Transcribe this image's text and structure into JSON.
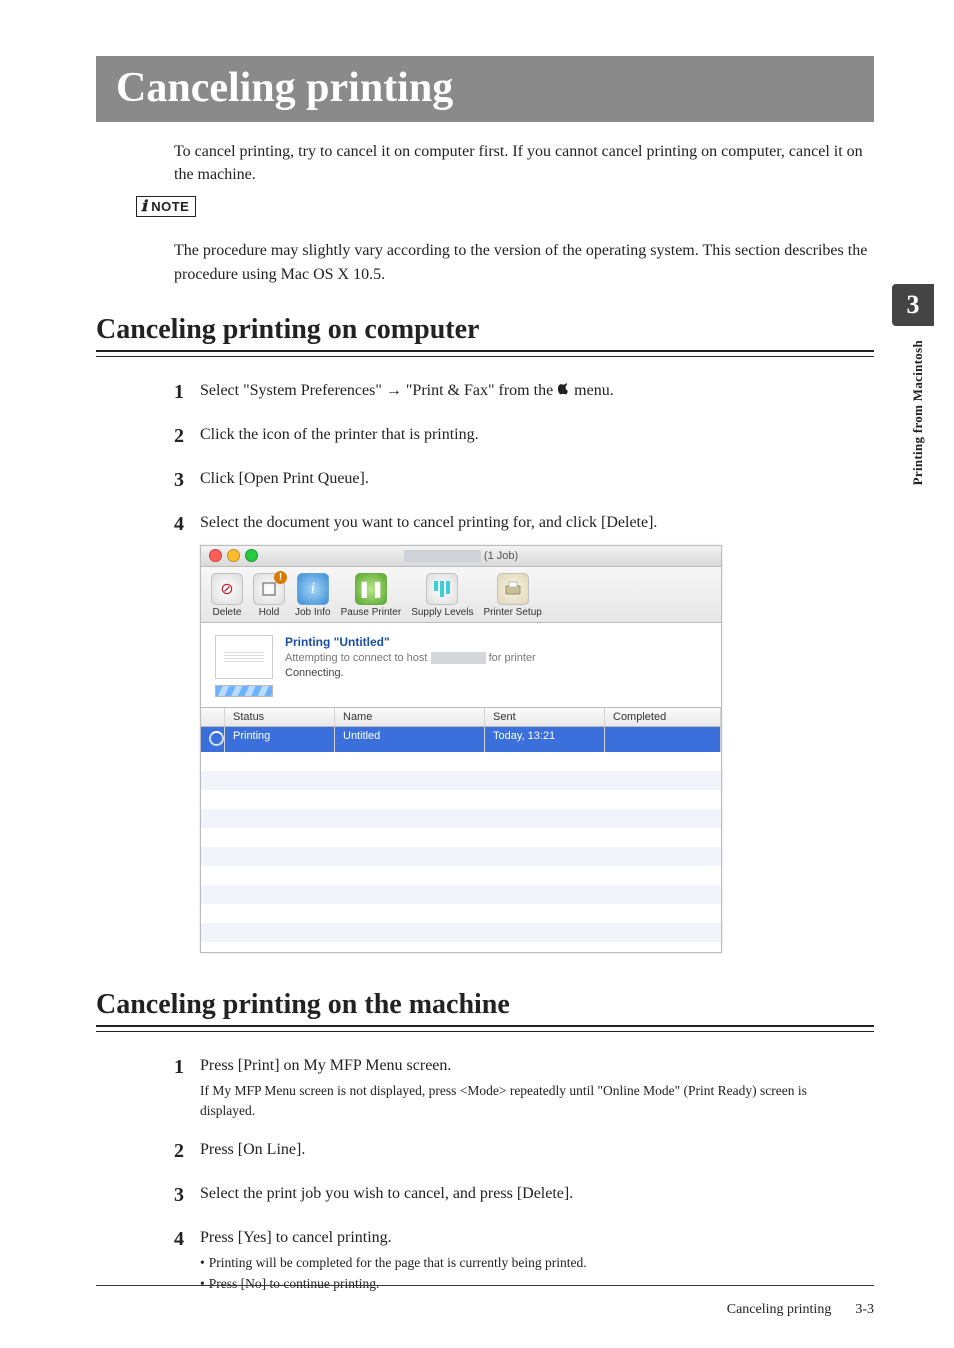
{
  "side": {
    "tab_number": "3",
    "vertical_label": "Printing from Macintosh"
  },
  "banner_title": "Canceling printing",
  "intro": "To cancel printing, try to cancel it on computer first.  If you cannot cancel printing on computer, cancel it on the machine.",
  "note": {
    "label": "NOTE",
    "text": "The procedure may slightly vary according to the version of the operating system. This section describes the procedure using Mac OS X 10.5."
  },
  "section_computer": {
    "heading": "Canceling printing on computer",
    "step1_pre": "Select \"System Preferences\" ",
    "step1_mid": " \"Print & Fax\" from the ",
    "step1_post": " menu.",
    "arrow": "→",
    "step2": "Click the icon of the printer that is printing.",
    "step3": "Click [Open Print Queue].",
    "step4": "Select the document you want to cancel printing for, and click [Delete]."
  },
  "screenshot": {
    "title_suffix": "(1 Job)",
    "toolbar": {
      "delete": "Delete",
      "hold": "Hold",
      "jobinfo": "Job Info",
      "pause": "Pause Printer",
      "supply": "Supply Levels",
      "setup": "Printer Setup"
    },
    "status_line1": "Printing \"Untitled\"",
    "status_line2": "Attempting to connect to host                       for printer",
    "status_line3": "Connecting.",
    "headers": {
      "status": "Status",
      "name": "Name",
      "sent": "Sent",
      "completed": "Completed"
    },
    "row": {
      "status": "Printing",
      "name": "Untitled",
      "sent": "Today, 13:21",
      "completed": ""
    }
  },
  "section_machine": {
    "heading": "Canceling printing on the machine",
    "step1": "Press [Print] on My MFP Menu screen.",
    "step1_sub": "If My MFP Menu screen is not displayed, press <Mode> repeatedly until \"Online Mode\" (Print Ready) screen is displayed.",
    "step2": "Press [On Line].",
    "step3": "Select the print job you wish to cancel, and press [Delete].",
    "step4": "Press [Yes] to cancel printing.",
    "step4_bullets": [
      "Printing will be completed for the page that is currently being printed.",
      "Press [No] to continue printing."
    ]
  },
  "footer": {
    "title": "Canceling printing",
    "page": "3-3"
  }
}
